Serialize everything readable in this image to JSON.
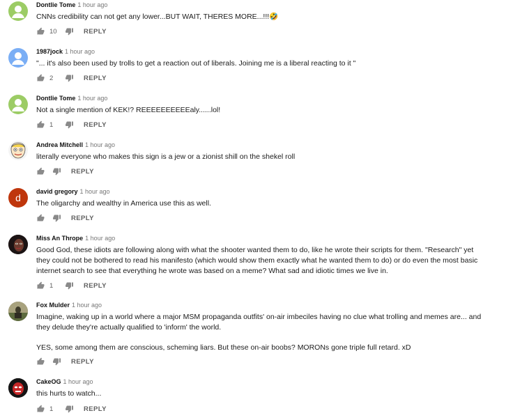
{
  "comments": [
    {
      "author": "Dontlie Tome",
      "time": "1 hour ago",
      "text": [
        "CNNs credibility can not get any lower...BUT WAIT, THERES MORE...!!!🤣"
      ],
      "likes": "10",
      "reply": "REPLY",
      "avatar": "green-person-avatar"
    },
    {
      "author": "1987jock",
      "time": "1 hour ago",
      "text": [
        "\"... it's also been used by trolls to get a reaction out of liberals. Joining me is a liberal reacting to it \""
      ],
      "likes": "2",
      "reply": "REPLY",
      "avatar": "blue-person-avatar"
    },
    {
      "author": "Dontlie Tome",
      "time": "1 hour ago",
      "text": [
        "Not a single mention of KEK!? REEEEEEEEEEaly......lol!"
      ],
      "likes": "1",
      "reply": "REPLY",
      "avatar": "green-person-avatar"
    },
    {
      "author": "Andrea Mitchell",
      "time": "1 hour ago",
      "text": [
        "literally everyone who makes this sign is a  jew or  a zionist shill on the shekel roll"
      ],
      "likes": "",
      "reply": "REPLY",
      "avatar": "cartoon-face-avatar"
    },
    {
      "author": "david gregory",
      "time": "1 hour ago",
      "text": [
        "The oligarchy and wealthy in America use this as well."
      ],
      "likes": "",
      "reply": "REPLY",
      "avatar": "letter-avatar",
      "avatar_letter": "d"
    },
    {
      "author": "Miss An Thrope",
      "time": "1 hour ago",
      "text": [
        "Good God, these idiots are following along with what the shooter wanted them to do, like he wrote their scripts for them. \"Research\" yet they could not be bothered to read his manifesto (which would show them exactly what he wanted them to do) or do even the most basic internet search to see that everything he wrote was based on a meme? What sad and idiotic times we live in."
      ],
      "likes": "1",
      "reply": "REPLY",
      "avatar": "dark-face-avatar"
    },
    {
      "author": "Fox Mulder",
      "time": "1 hour ago",
      "text": [
        "Imagine, waking up in a world where a major MSM propaganda outfits' on-air imbeciles having no clue what trolling and memes are... and they delude they're actually qualified to 'inform' the world.",
        "YES, some among them are conscious, scheming liars. But these on-air boobs? MORONs gone triple full retard. xD"
      ],
      "likes": "",
      "reply": "REPLY",
      "avatar": "photo-avatar"
    },
    {
      "author": "CakeOG",
      "time": "1 hour ago",
      "text": [
        "this hurts to watch..."
      ],
      "likes": "1",
      "reply": "REPLY",
      "avatar": "masked-face-avatar"
    }
  ],
  "colors": {
    "green": "#8bc34a",
    "blue": "#7aaef5",
    "red": "#bf360c",
    "meta": "#606060"
  }
}
